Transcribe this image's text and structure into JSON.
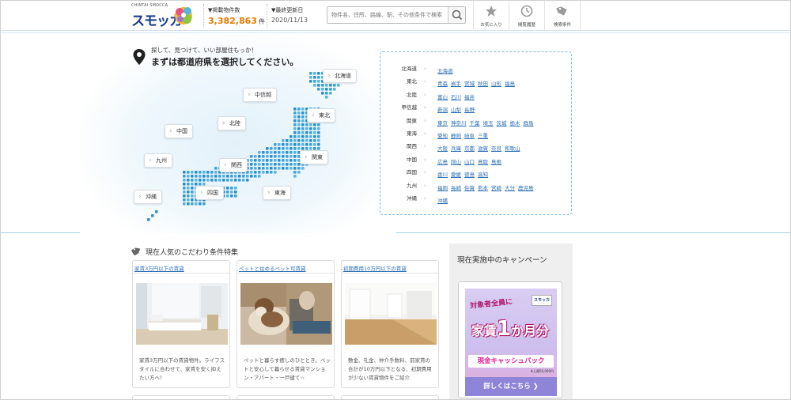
{
  "header": {
    "logo_small": "CHINTAI SMOCCA",
    "logo_main": "スモッカ",
    "listing_label": "▼掲載物件数",
    "listing_count": "3,382,863",
    "listing_unit": "件",
    "updated_label": "▼最終更新日",
    "updated_date": "2020/11/13",
    "search_placeholder": "物件名、住所、路線、駅、その他条件で検索",
    "icons": [
      {
        "label": "お気に入り",
        "icon": "star-icon"
      },
      {
        "label": "閲覧履歴",
        "icon": "clock-icon"
      },
      {
        "label": "検索条件",
        "icon": "tag-icon"
      }
    ]
  },
  "map": {
    "tagline_small": "探して、見つけて、いい部屋住もっか！",
    "tagline_big": "まずは都道府県を選択してください。",
    "regions": {
      "hokkaido": "北海道",
      "tohoku": "東北",
      "chubu": "中信越",
      "hokuriku": "北陸",
      "chugoku": "中国",
      "kanto": "関東",
      "kyushu": "九州",
      "kansai": "関西",
      "shikoku": "四国",
      "tokai": "東海",
      "okinawa": "沖縄"
    }
  },
  "prefectures": [
    {
      "region": "北海道",
      "prefs": [
        "北海道"
      ]
    },
    {
      "region": "東北",
      "prefs": [
        "青森",
        "岩手",
        "宮城",
        "秋田",
        "山形",
        "福島"
      ]
    },
    {
      "region": "北陸",
      "prefs": [
        "富山",
        "石川",
        "福井"
      ]
    },
    {
      "region": "甲信越",
      "prefs": [
        "新潟",
        "山梨",
        "長野"
      ]
    },
    {
      "region": "関東",
      "prefs": [
        "東京",
        "神奈川",
        "千葉",
        "埼玉",
        "茨城",
        "栃木",
        "群馬"
      ]
    },
    {
      "region": "東海",
      "prefs": [
        "愛知",
        "静岡",
        "岐阜",
        "三重"
      ]
    },
    {
      "region": "関西",
      "prefs": [
        "大阪",
        "兵庫",
        "京都",
        "滋賀",
        "奈良",
        "和歌山"
      ]
    },
    {
      "region": "中国",
      "prefs": [
        "広島",
        "岡山",
        "山口",
        "鳥取",
        "島根"
      ]
    },
    {
      "region": "四国",
      "prefs": [
        "香川",
        "愛媛",
        "徳島",
        "高知"
      ]
    },
    {
      "region": "九州",
      "prefs": [
        "福岡",
        "長崎",
        "佐賀",
        "熊本",
        "宮崎",
        "大分",
        "鹿児島"
      ]
    },
    {
      "region": "沖縄",
      "prefs": [
        "沖縄"
      ]
    }
  ],
  "features": {
    "title": "現在人気のこだわり条件特集",
    "cards": [
      {
        "head": "家賃3万円以下の賃貸",
        "desc": "家賃3万円以下の賃貸物件。ライフスタイルに合わせて、家賃を安く抑えたい方へ！"
      },
      {
        "head": "ペットと住めるペット可賃貸",
        "desc": "ペットと暮らす癒しのひととき。ペットと安心して暮らせる賃貸マンション・アパート・一戸建て☆"
      },
      {
        "head": "初期費用10万円以下の賃貸",
        "desc": "敷金、礼金、仲介手数料、前家賃の合計が10万円以下となる、初期費用が少ない賃貸物件をご紹介"
      }
    ]
  },
  "campaign": {
    "title": "現在実施中のキャンペーン",
    "banner_top": "対象者全員に",
    "banner_main_a": "家賃",
    "banner_main_num": "1",
    "banner_main_b": "か月分",
    "banner_cash": "現金キャッシュバック",
    "banner_note": "※上限50,000円",
    "banner_button": "詳しくはこちら ❯",
    "banner_logo": "スモッカ"
  }
}
